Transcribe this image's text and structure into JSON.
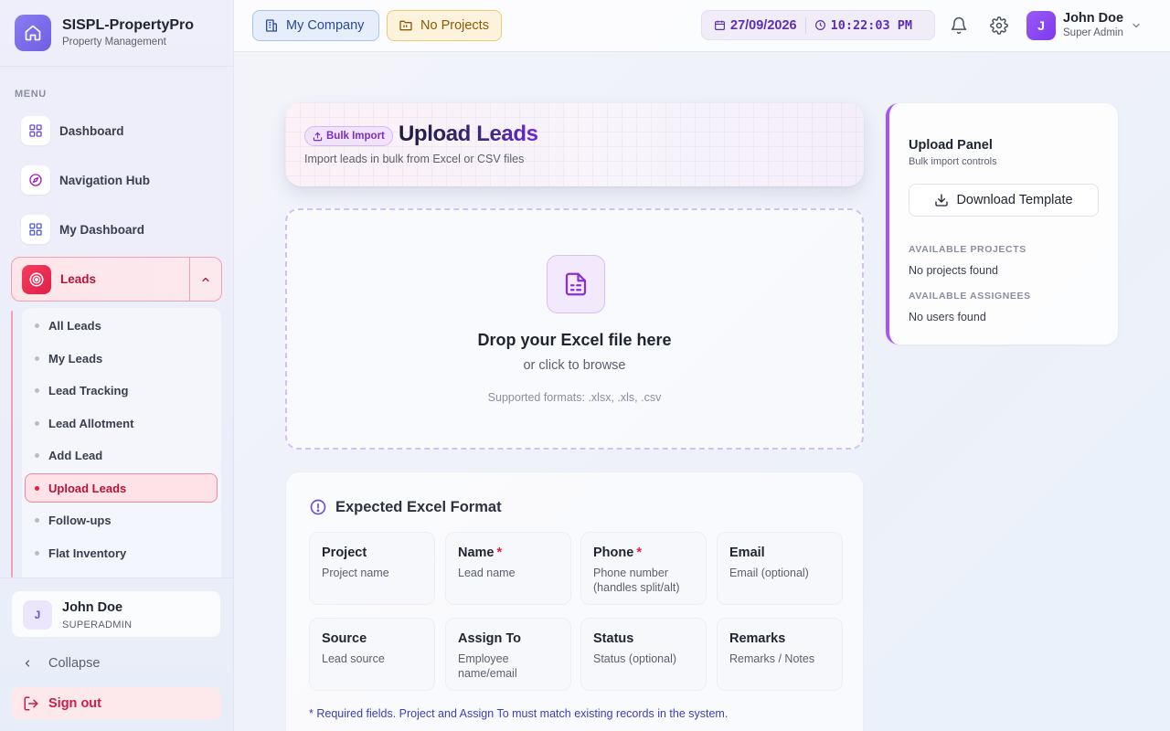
{
  "brand": {
    "name": "SISPL-PropertyPro",
    "subtitle": "Property Management"
  },
  "sidebar": {
    "menu_label": "MENU",
    "items": [
      {
        "label": "Dashboard",
        "icon": "grid-icon"
      },
      {
        "label": "Navigation Hub",
        "icon": "compass-icon"
      },
      {
        "label": "My Dashboard",
        "icon": "grid-icon"
      }
    ],
    "leads": {
      "label": "Leads",
      "icon": "target-icon",
      "expanded": true,
      "sub_items": [
        "All Leads",
        "My Leads",
        "Lead Tracking",
        "Lead Allotment",
        "Add Lead",
        "Upload Leads",
        "Follow-ups",
        "Flat Inventory"
      ],
      "active": "Upload Leads"
    },
    "user": {
      "initial": "J",
      "name": "John Doe",
      "role": "SUPERADMIN"
    },
    "collapse_label": "Collapse",
    "signout_label": "Sign out"
  },
  "topbar": {
    "company_chip": "My Company",
    "project_chip": "No Projects",
    "date": "27/09/2026",
    "time": "10:22:03 PM",
    "user": {
      "initial": "J",
      "name": "John Doe",
      "role": "Super Admin"
    }
  },
  "header": {
    "badge": "Bulk Import",
    "title": "Upload Leads",
    "subtitle": "Import leads in bulk from Excel or CSV files"
  },
  "dropzone": {
    "title": "Drop your Excel file here",
    "subtitle": "or click to browse",
    "formats": "Supported formats: .xlsx, .xls, .csv"
  },
  "format": {
    "title": "Expected Excel Format",
    "fields": [
      {
        "name": "Project",
        "desc": "Project name",
        "required": false
      },
      {
        "name": "Name",
        "desc": "Lead name",
        "required": true
      },
      {
        "name": "Phone",
        "desc": "Phone number (handles split/alt)",
        "required": true
      },
      {
        "name": "Email",
        "desc": "Email (optional)",
        "required": false
      },
      {
        "name": "Source",
        "desc": "Lead source",
        "required": false
      },
      {
        "name": "Assign To",
        "desc": "Employee name/email",
        "required": false
      },
      {
        "name": "Status",
        "desc": "Status (optional)",
        "required": false
      },
      {
        "name": "Remarks",
        "desc": "Remarks / Notes",
        "required": false
      }
    ],
    "note": "* Required fields. Project and Assign To must match existing records in the system."
  },
  "panel": {
    "title": "Upload Panel",
    "subtitle": "Bulk import controls",
    "download_label": "Download Template",
    "projects_label": "AVAILABLE PROJECTS",
    "projects_value": "No projects found",
    "assignees_label": "AVAILABLE ASSIGNEES",
    "assignees_value": "No users found"
  },
  "colors": {
    "accent": "#7c3aed",
    "leads_red": "#e11d48",
    "company_blue": "#2a4a8f",
    "project_amber": "#8a5a08"
  }
}
